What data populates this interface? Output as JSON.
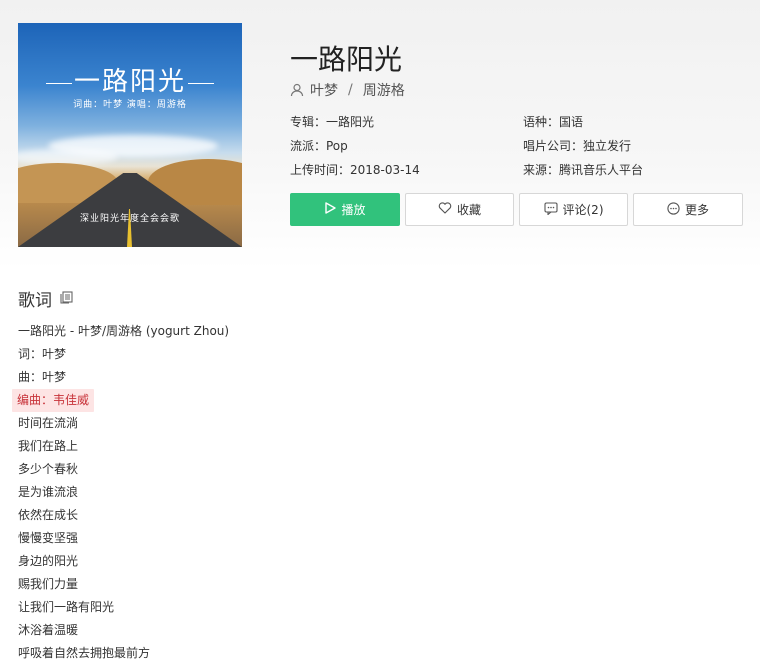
{
  "song": {
    "title": "一路阳光",
    "artists": [
      "叶梦",
      "周游格"
    ],
    "separator": "/"
  },
  "cover": {
    "title": "一路阳光",
    "subtitle": "词曲：叶梦   演唱：周游格",
    "bottom_text": "深业阳光年度全会会歌"
  },
  "meta": {
    "album": "专辑：一路阳光",
    "genre": "流派：Pop",
    "upload_date": "上传时间：2018-03-14",
    "language": "语种：国语",
    "label": "唱片公司：独立发行",
    "source": "来源：腾讯音乐人平台"
  },
  "buttons": {
    "play": "播放",
    "favorite": "收藏",
    "comment": "评论(2)",
    "more": "更多"
  },
  "lyrics": {
    "heading": "歌词",
    "lines": [
      "一路阳光 - 叶梦/周游格 (yogurt Zhou)",
      "词：叶梦",
      "曲：叶梦",
      "编曲：韦佳威",
      "时间在流淌",
      "我们在路上",
      "多少个春秋",
      "是为谁流浪",
      "依然在成长",
      "慢慢变坚强",
      "身边的阳光",
      "赐我们力量",
      "让我们一路有阳光",
      "沐浴着温暖",
      "呼吸着自然去拥抱最前方"
    ],
    "active_index": 3
  },
  "colors": {
    "accent": "#31c27c",
    "highlight_bg": "#fde4e4",
    "highlight_text": "#c8333a"
  }
}
